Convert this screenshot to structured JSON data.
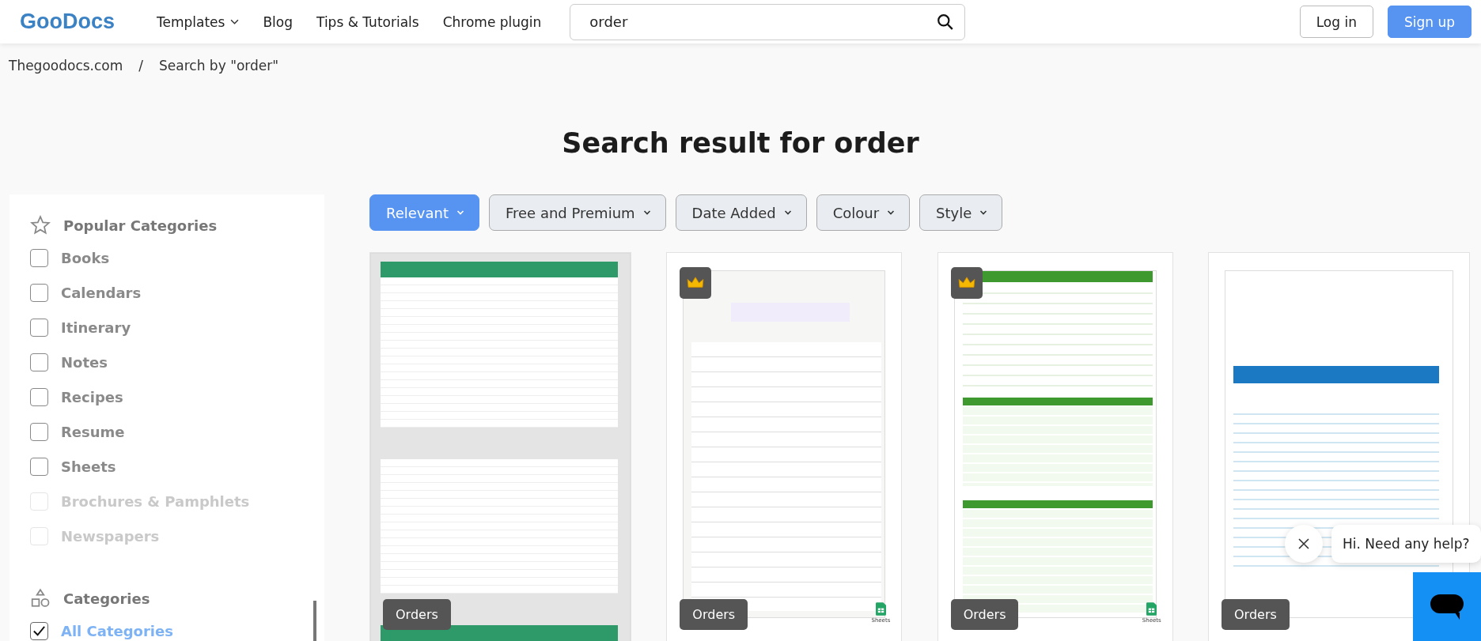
{
  "header": {
    "logo": "GooDocs",
    "nav": [
      {
        "label": "Templates",
        "dropdown": true
      },
      {
        "label": "Blog",
        "dropdown": false
      },
      {
        "label": "Tips & Tutorials",
        "dropdown": false
      },
      {
        "label": "Chrome plugin",
        "dropdown": false
      }
    ],
    "search": {
      "value": "order"
    },
    "buttons": [
      {
        "label": "Log in",
        "kind": "outline"
      },
      {
        "label": "Sign up",
        "kind": "primary"
      }
    ]
  },
  "breadcrumb": [
    {
      "kind": "link",
      "text": "Thegoodocs.com"
    },
    {
      "kind": "separator",
      "text": "/"
    },
    {
      "kind": "link",
      "text": "Search by \"order\""
    }
  ],
  "title": "Search result for order",
  "sidebar": {
    "sections": [
      {
        "title": "Popular Categories",
        "items": [
          {
            "label": "Books",
            "checked": false,
            "disabled": false
          },
          {
            "label": "Calendars",
            "checked": false,
            "disabled": false
          },
          {
            "label": "Itinerary",
            "checked": false,
            "disabled": false
          },
          {
            "label": "Notes",
            "checked": false,
            "disabled": false
          },
          {
            "label": "Recipes",
            "checked": false,
            "disabled": false
          },
          {
            "label": "Resume",
            "checked": false,
            "disabled": false
          },
          {
            "label": "Sheets",
            "checked": false,
            "disabled": false
          },
          {
            "label": "Brochures & Pamphlets",
            "checked": false,
            "disabled": true
          },
          {
            "label": "Newspapers",
            "checked": false,
            "disabled": true
          }
        ]
      },
      {
        "title": "Categories",
        "items": [
          {
            "label": "All Categories",
            "checked": true,
            "disabled": false
          }
        ]
      }
    ]
  },
  "filters": [
    {
      "label": "Relevant",
      "selected": true
    },
    {
      "label": "Free and Premium",
      "selected": false
    },
    {
      "label": "Date Added",
      "selected": false
    },
    {
      "label": "Colour",
      "selected": false
    },
    {
      "label": "Style",
      "selected": false
    }
  ],
  "cards": [
    {
      "kind": "tracker",
      "premium": false,
      "tag": "Orders"
    },
    {
      "kind": "form",
      "premium": true,
      "tag": "Orders",
      "app_label": "Sheets"
    },
    {
      "kind": "sheet",
      "premium": true,
      "tag": "Orders",
      "app_label": "Sheets"
    },
    {
      "kind": "invoice",
      "premium": false,
      "tag": "Orders"
    }
  ],
  "chat": {
    "message": "Hi. Need any help?"
  }
}
